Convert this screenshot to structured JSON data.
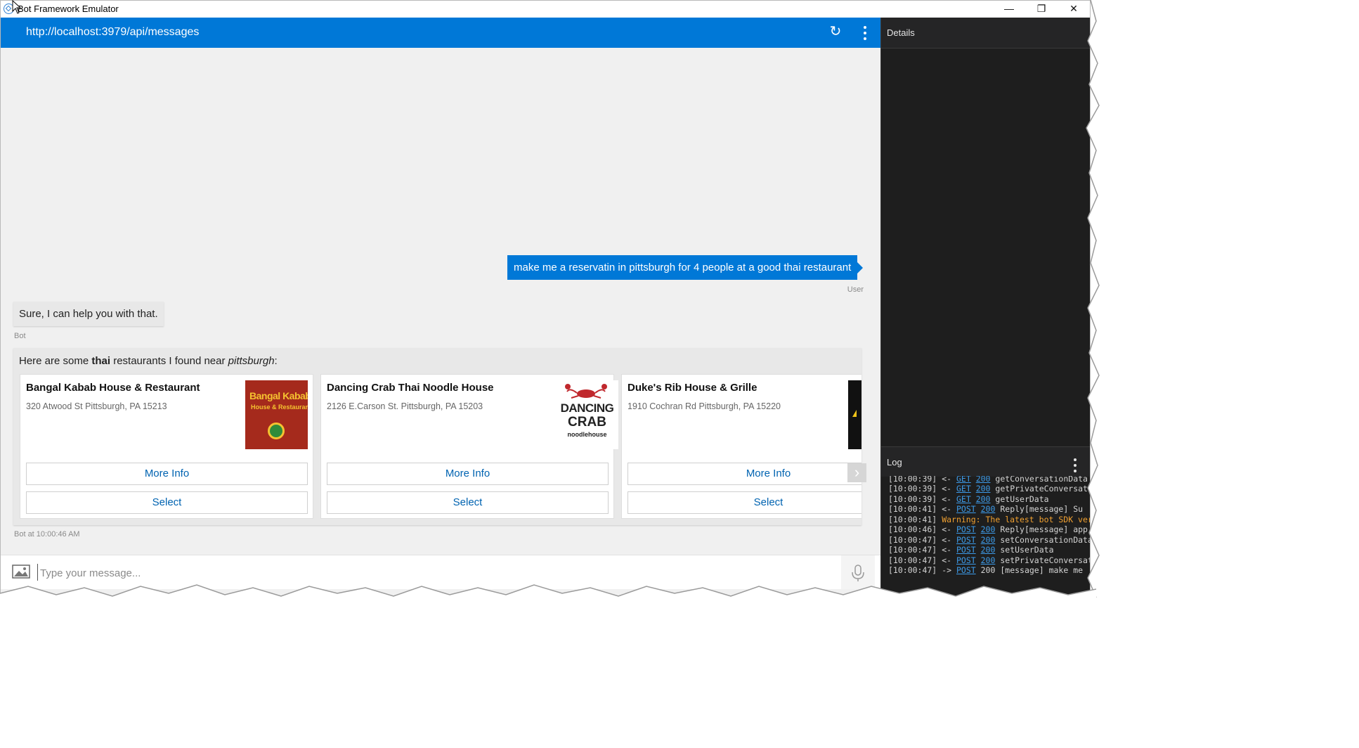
{
  "window": {
    "title": "Bot Framework Emulator",
    "controls": {
      "minimize": "—",
      "maximize": "❐",
      "close": "✕"
    }
  },
  "address_bar": {
    "url": "http://localhost:3979/api/messages",
    "refresh_icon": "↻"
  },
  "conversation": {
    "user_message": "make me a reservatin in pittsburgh for 4 people at a good thai restaurant",
    "user_label": "User",
    "bot_message": "Sure, I can help you with that.",
    "bot_label": "Bot",
    "carousel_intro": {
      "prefix": "Here are some ",
      "cuisine": "thai",
      "middle": " restaurants I found near ",
      "city": "pittsburgh",
      "suffix": ":"
    },
    "cards": [
      {
        "title": "Bangal Kabab House & Restaurant",
        "address": "320 Atwood St Pittsburgh, PA 15213",
        "image_text_1": "Bangal Kabab",
        "image_text_2": "House & Restaurant",
        "more_info": "More Info",
        "select": "Select"
      },
      {
        "title": "Dancing Crab Thai Noodle House",
        "address": "2126 E.Carson St. Pittsburgh, PA 15203",
        "image_text_1": "DANCING",
        "image_text_2": "CRAB",
        "image_text_3": "noodlehouse",
        "more_info": "More Info",
        "select": "Select"
      },
      {
        "title": "Duke's Rib House & Grille",
        "address": "1910 Cochran Rd Pittsburgh, PA 15220",
        "more_info": "More Info",
        "select": "Select"
      }
    ],
    "carousel_next_icon": "›",
    "bot_timestamp": "Bot at 10:00:46 AM"
  },
  "input": {
    "placeholder": "Type your message..."
  },
  "details_panel": {
    "title": "Details"
  },
  "log_panel": {
    "title": "Log",
    "lines": [
      {
        "time": "[10:00:39]",
        "dir": "<-",
        "method": "GET",
        "status": "200",
        "text": "getConversationData"
      },
      {
        "time": "[10:00:39]",
        "dir": "<-",
        "method": "GET",
        "status": "200",
        "text": "getPrivateConversat"
      },
      {
        "time": "[10:00:39]",
        "dir": "<-",
        "method": "GET",
        "status": "200",
        "text": "getUserData"
      },
      {
        "time": "[10:00:41]",
        "dir": "<-",
        "method": "POST",
        "status": "200",
        "text": "Reply[message] Su"
      },
      {
        "time": "[10:00:41]",
        "warning": "Warning: The latest bot SDK ver"
      },
      {
        "time": "[10:00:46]",
        "dir": "<-",
        "method": "POST",
        "status": "200",
        "text": "Reply[message] app"
      },
      {
        "time": "[10:00:47]",
        "dir": "<-",
        "method": "POST",
        "status": "200",
        "text": "setConversationData"
      },
      {
        "time": "[10:00:47]",
        "dir": "<-",
        "method": "POST",
        "status": "200",
        "text": "setUserData"
      },
      {
        "time": "[10:00:47]",
        "dir": "<-",
        "method": "POST",
        "status": "200",
        "text": "setPrivateConversat"
      },
      {
        "time": "[10:00:47]",
        "dir": "->",
        "method": "POST",
        "status": "200",
        "text": "[message] make me"
      }
    ]
  },
  "colors": {
    "accent": "#0078d7",
    "link": "#0063b1",
    "panel_dark": "#1e1e1e",
    "log_link": "#3d9be9",
    "log_warning": "#f0a030"
  },
  "icons": {
    "app": "bot-emulator-icon",
    "refresh": "refresh-icon",
    "menu": "more-vertical-icon",
    "attach": "image-icon",
    "mic": "microphone-icon",
    "next": "chevron-right-icon"
  }
}
